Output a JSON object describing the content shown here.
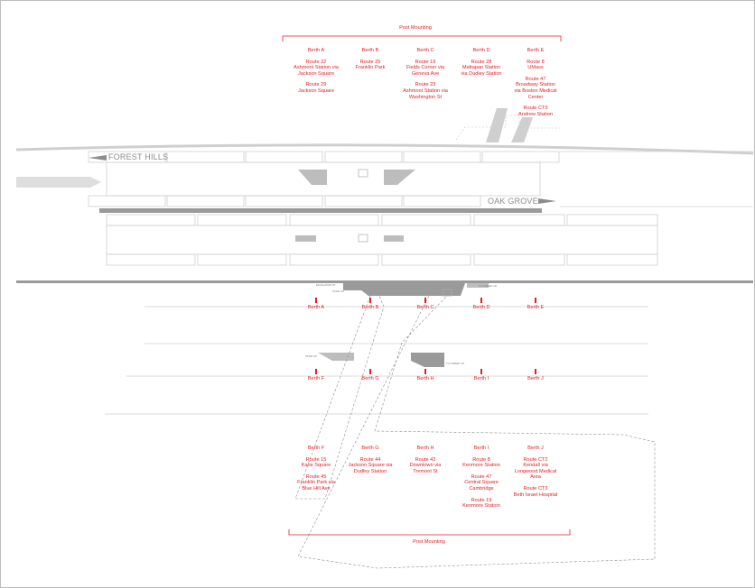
{
  "top": {
    "title": "Post Mounting",
    "berths": [
      {
        "name": "Berth A",
        "routes": [
          "Route 22\nAshmont Station via\nJackson Square",
          "Route 29\nJackson Square"
        ]
      },
      {
        "name": "Berth B",
        "routes": [
          "Route 25\nFranklin Park"
        ]
      },
      {
        "name": "Berth C",
        "routes": [
          "Route 19\nFields Corner via\nGeneva Ave",
          "Route 23\nAshmont Station via\nWashington St"
        ]
      },
      {
        "name": "Berth D",
        "routes": [
          "Route 28\nMattapan Station\nvia Dudley Station"
        ]
      },
      {
        "name": "Berth E",
        "routes": [
          "Route 8\nUMass",
          "Route 47\nBroadway Station\nvia Boston Medical\nCenter",
          "Route CT3\nAndrew Station"
        ]
      }
    ]
  },
  "signs": {
    "forest_hills": "FOREST HILLS",
    "oak_grove": "OAK GROVE"
  },
  "platform_row1": [
    "Berth A",
    "Berth B",
    "Berth C",
    "Berth D",
    "Berth E"
  ],
  "platform_row2": [
    "Berth F",
    "Berth G",
    "Berth H",
    "Berth I",
    "Berth J"
  ],
  "tiny_labels": {
    "esc_up": "ESCALATOR UP",
    "stair_up_1": "STAIR UP",
    "stair_up_2": "STAIR UP",
    "to_street": "TO STREET UP",
    "stair_up_3": "STAIR UP",
    "to_street_2": "TO STREET UP"
  },
  "bottom": {
    "title": "Post Mounting",
    "berths": [
      {
        "name": "Berth F",
        "routes": [
          "Route 15\nKane Square",
          "Route 45\nFranklin Park via\nBlue Hill Ave"
        ]
      },
      {
        "name": "Berth G",
        "routes": [
          "Route 44\nJackson Square via\nDudley Station"
        ]
      },
      {
        "name": "Berth H",
        "routes": [
          "Route 43\nDowntown via\nTremont St"
        ]
      },
      {
        "name": "Berth I",
        "routes": [
          "Route 8\nKenmore Station",
          "Route 47\nCentral Square\nCambridge",
          "Route 19\nKenmore Station"
        ]
      },
      {
        "name": "Berth J",
        "routes": [
          "Route CT2\nKendall via\nLongwood Medical\nArea",
          "Route CT3\nBeth Israel Hospital"
        ]
      }
    ]
  },
  "colors": {
    "accent": "#e31e24",
    "line": "#c8c8c8",
    "fill": "#9a9a9a"
  }
}
